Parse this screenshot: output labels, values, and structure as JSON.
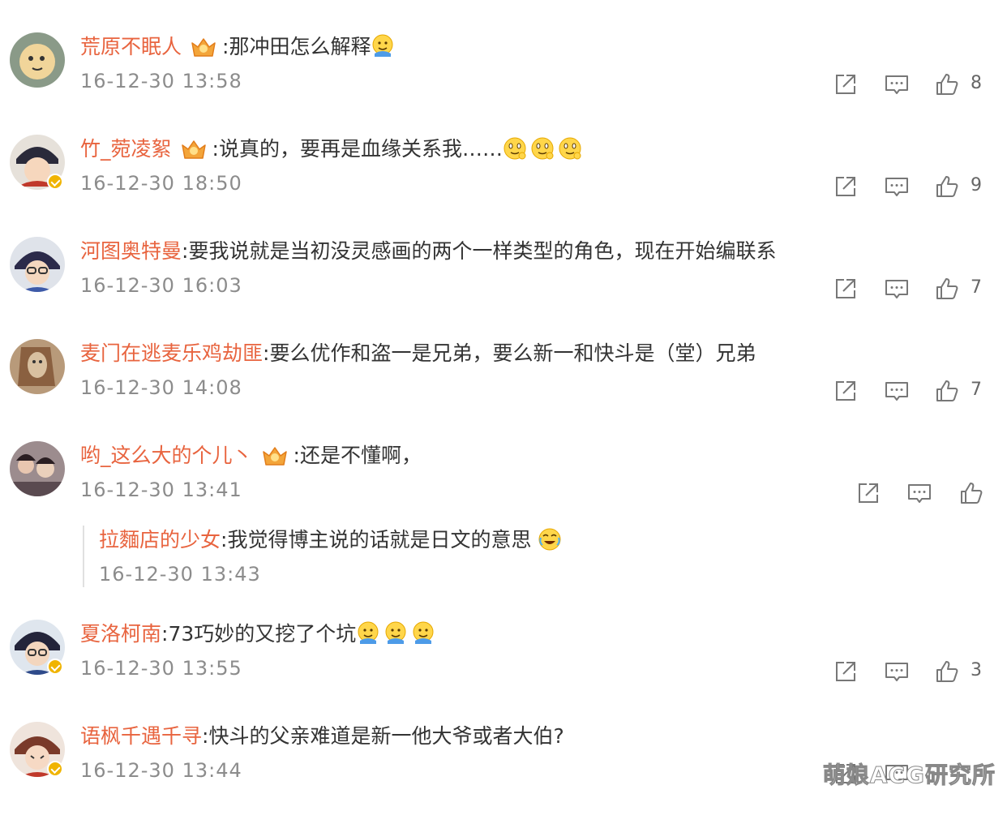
{
  "comments": [
    {
      "user": "荒原不眠人",
      "text": ":那冲田怎么解释",
      "time": "16-12-30 13:58",
      "likes": "8"
    },
    {
      "user": "竹_菀凌絮",
      "text": ":说真的，要再是血缘关系我……",
      "time": "16-12-30 18:50",
      "likes": "9"
    },
    {
      "user": "河图奥特曼",
      "text": ":要我说就是当初没灵感画的两个一样类型的角色，现在开始编联系",
      "time": "16-12-30 16:03",
      "likes": "7"
    },
    {
      "user": "麦门在逃麦乐鸡劫匪",
      "text": ":要么优作和盗一是兄弟，要么新一和快斗是（堂）兄弟",
      "time": "16-12-30 14:08",
      "likes": "7"
    },
    {
      "user": "哟_这么大的个儿丶",
      "text": ":还是不懂啊，",
      "time": "16-12-30 13:41",
      "likes": ""
    },
    {
      "user": "夏洛柯南",
      "text": ":73巧妙的又挖了个坑",
      "time": "16-12-30 13:55",
      "likes": "3"
    },
    {
      "user": "语枫千遇千寻",
      "text": ":快斗的父亲难道是新一他大爷或者大伯?",
      "time": "16-12-30 13:44",
      "likes": ""
    }
  ],
  "reply": {
    "user": "拉麵店的少女",
    "text": ":我觉得博主说的话就是日文的意思",
    "time": "16-12-30 13:43"
  },
  "watermark": "萌娘ACG研究所",
  "icons": [
    "share-icon",
    "comment-icon",
    "thumbs-up-icon",
    "vip-crown-icon",
    "verified-icon",
    "emoji-icon"
  ],
  "colors": {
    "username": "#e8643f",
    "time": "#8c8c8c",
    "text": "#333333",
    "vip": "#f0b400"
  }
}
